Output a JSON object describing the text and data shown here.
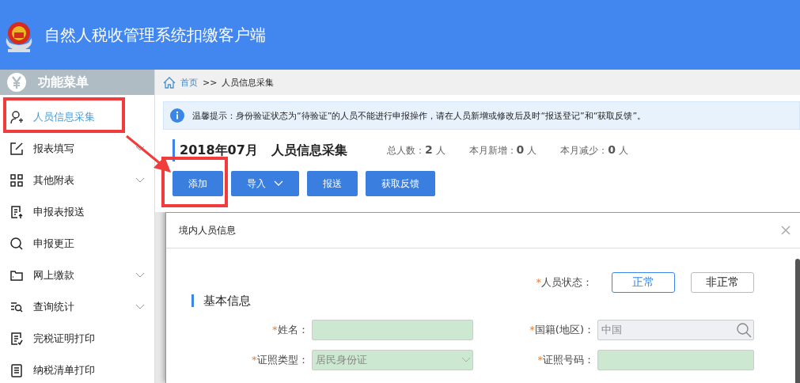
{
  "header": {
    "title": "自然人税收管理系统扣缴客户端"
  },
  "sidebar": {
    "title": "功能菜单",
    "items": [
      {
        "label": "人员信息采集",
        "selected": true,
        "expandable": false
      },
      {
        "label": "报表填写",
        "selected": false,
        "expandable": true
      },
      {
        "label": "其他附表",
        "selected": false,
        "expandable": true
      },
      {
        "label": "申报表报送",
        "selected": false,
        "expandable": false
      },
      {
        "label": "申报更正",
        "selected": false,
        "expandable": false
      },
      {
        "label": "网上缴款",
        "selected": false,
        "expandable": true
      },
      {
        "label": "查询统计",
        "selected": false,
        "expandable": true
      },
      {
        "label": "完税证明打印",
        "selected": false,
        "expandable": false
      },
      {
        "label": "纳税清单打印",
        "selected": false,
        "expandable": false
      }
    ]
  },
  "breadcrumb": {
    "home": "首页",
    "separator": ">>",
    "current": "人员信息采集"
  },
  "notice": "温馨提示：身份验证状态为“待验证”的人员不能进行申报操作，请在人员新增或修改后及时“报送登记”和“获取反馈”。",
  "page": {
    "title": "2018年07月   人员信息采集",
    "stats": [
      {
        "label": "总人数：",
        "value": "2",
        "unit": "人"
      },
      {
        "label": "本月新增：",
        "value": "0",
        "unit": "人"
      },
      {
        "label": "本月减少：",
        "value": "0",
        "unit": "人"
      }
    ]
  },
  "toolbar": [
    {
      "label": "添加",
      "dropdown": false
    },
    {
      "label": "导入",
      "dropdown": true
    },
    {
      "label": "报送",
      "dropdown": false
    },
    {
      "label": "获取反馈",
      "dropdown": false
    }
  ],
  "dialog": {
    "title": "境内人员信息",
    "required_mark": "*",
    "status_required": true,
    "status_label": "人员状态：",
    "status_options": [
      {
        "label": "正常",
        "selected": true
      },
      {
        "label": "非正常",
        "selected": false
      }
    ],
    "section": "基本信息",
    "fields": [
      {
        "label": "姓名：",
        "required": true,
        "kind": "text",
        "highlighted": true
      },
      {
        "label": "国籍(地区)：",
        "required": true,
        "kind": "search",
        "value": "中国",
        "highlighted": false
      },
      {
        "label": "证照类型：",
        "required": true,
        "kind": "select",
        "value": "居民身份证",
        "highlighted": true
      },
      {
        "label": "证照号码：",
        "required": true,
        "kind": "text",
        "highlighted": true
      }
    ]
  }
}
